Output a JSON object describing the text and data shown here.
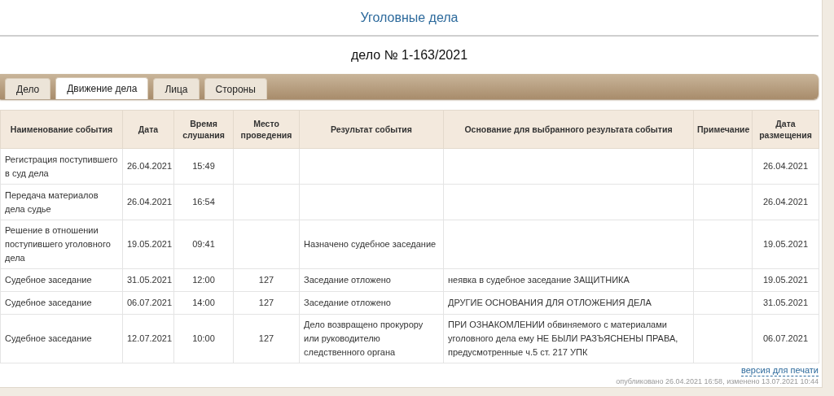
{
  "section_title": "Уголовные дела",
  "case_title": "дело № 1-163/2021",
  "tabs": [
    {
      "label": "Дело",
      "selected": false
    },
    {
      "label": "Движение дела",
      "selected": true
    },
    {
      "label": "Лица",
      "selected": false
    },
    {
      "label": "Стороны",
      "selected": false
    }
  ],
  "table": {
    "columns": [
      "Наименование события",
      "Дата",
      "Время слушания",
      "Место проведения",
      "Результат события",
      "Основание для выбранного результата события",
      "Примечание",
      "Дата размещения"
    ],
    "rows": [
      [
        "Регистрация поступившего в суд дела",
        "26.04.2021",
        "15:49",
        "",
        "",
        "",
        "",
        "26.04.2021"
      ],
      [
        "Передача материалов дела судье",
        "26.04.2021",
        "16:54",
        "",
        "",
        "",
        "",
        "26.04.2021"
      ],
      [
        "Решение в отношении поступившего уголовного дела",
        "19.05.2021",
        "09:41",
        "",
        "Назначено судебное заседание",
        "",
        "",
        "19.05.2021"
      ],
      [
        "Судебное заседание",
        "31.05.2021",
        "12:00",
        "127",
        "Заседание отложено",
        "неявка в судебное заседание ЗАЩИТНИКА",
        "",
        "19.05.2021"
      ],
      [
        "Судебное заседание",
        "06.07.2021",
        "14:00",
        "127",
        "Заседание отложено",
        "ДРУГИЕ ОСНОВАНИЯ ДЛЯ ОТЛОЖЕНИЯ ДЕЛА",
        "",
        "31.05.2021"
      ],
      [
        "Судебное заседание",
        "12.07.2021",
        "10:00",
        "127",
        "Дело возвращено прокурору или руководителю следственного органа",
        "ПРИ ОЗНАКОМЛЕНИИ обвиняемого с материалами уголовного дела ему НЕ БЫЛИ РАЗЪЯСНЕНЫ ПРАВА, предусмотренные ч.5 ст. 217 УПК",
        "",
        "06.07.2021"
      ]
    ]
  },
  "print_link": "версия для печати",
  "published": "опубликовано 26.04.2021 16:58, изменено 13.07.2021 10:44"
}
